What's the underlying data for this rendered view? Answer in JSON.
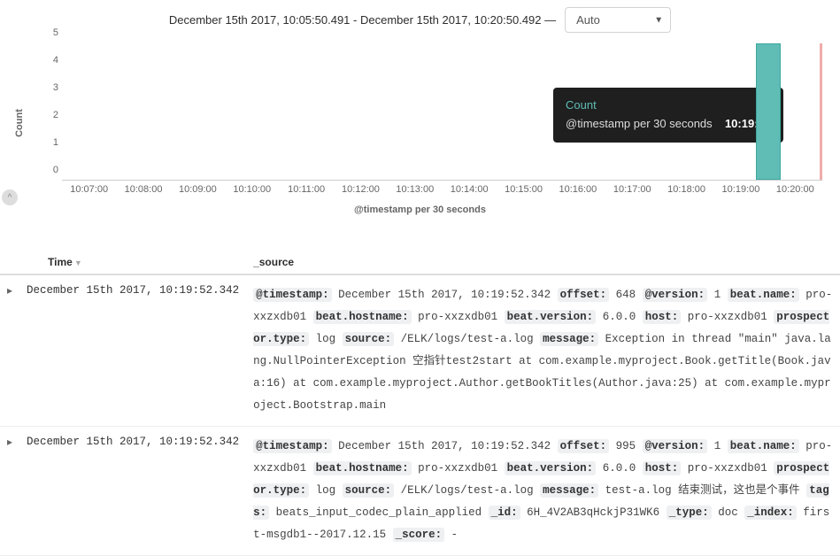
{
  "header": {
    "time_range": "December 15th 2017, 10:05:50.491 - December 15th 2017, 10:20:50.492 —",
    "interval_selected": "Auto"
  },
  "chart_data": {
    "type": "bar",
    "ylabel": "Count",
    "xlabel": "@timestamp per 30 seconds",
    "ylim": [
      0,
      5
    ],
    "y_ticks": [
      0,
      1,
      2,
      3,
      4,
      5
    ],
    "x_ticks": [
      "10:07:00",
      "10:08:00",
      "10:09:00",
      "10:10:00",
      "10:11:00",
      "10:12:00",
      "10:13:00",
      "10:14:00",
      "10:15:00",
      "10:16:00",
      "10:17:00",
      "10:18:00",
      "10:19:00",
      "10:20:00"
    ],
    "bars": [
      {
        "bucket": "10:19:30",
        "value": 5
      }
    ],
    "tooltip": {
      "count_label": "Count",
      "count_value": "5",
      "ts_label": "@timestamp per 30 seconds",
      "ts_value": "10:19:30"
    }
  },
  "table": {
    "columns": {
      "time": "Time",
      "source": "_source"
    },
    "rows": [
      {
        "time": "December 15th 2017, 10:19:52.342",
        "fields": [
          {
            "k": "@timestamp",
            "v": "December 15th 2017, 10:19:52.342"
          },
          {
            "k": "offset",
            "v": "648"
          },
          {
            "k": "@version",
            "v": "1"
          },
          {
            "k": "beat.name",
            "v": "pro-xxzxdb01"
          },
          {
            "k": "beat.hostname",
            "v": "pro-xxzxdb01"
          },
          {
            "k": "beat.version",
            "v": "6.0.0"
          },
          {
            "k": "host",
            "v": "pro-xxzxdb01"
          },
          {
            "k": "prospector.type",
            "v": "log"
          },
          {
            "k": "source",
            "v": "/ELK/logs/test-a.log"
          },
          {
            "k": "message",
            "v": "Exception in thread \"main\" java.lang.NullPointerException 空指针test2start at com.example.myproject.Book.getTitle(Book.java:16) at com.example.myproject.Author.getBookTitles(Author.java:25) at com.example.myproject.Bootstrap.main"
          }
        ]
      },
      {
        "time": "December 15th 2017, 10:19:52.342",
        "fields": [
          {
            "k": "@timestamp",
            "v": "December 15th 2017, 10:19:52.342"
          },
          {
            "k": "offset",
            "v": "995"
          },
          {
            "k": "@version",
            "v": "1"
          },
          {
            "k": "beat.name",
            "v": "pro-xxzxdb01"
          },
          {
            "k": "beat.hostname",
            "v": "pro-xxzxdb01"
          },
          {
            "k": "beat.version",
            "v": "6.0.0"
          },
          {
            "k": "host",
            "v": "pro-xxzxdb01"
          },
          {
            "k": "prospector.type",
            "v": "log"
          },
          {
            "k": "source",
            "v": "/ELK/logs/test-a.log"
          },
          {
            "k": "message",
            "v": "test-a.log 结束测试，这也是个事件"
          },
          {
            "k": "tags",
            "v": "beats_input_codec_plain_applied"
          },
          {
            "k": "_id",
            "v": "6H_4V2AB3qHckjP31WK6"
          },
          {
            "k": "_type",
            "v": "doc"
          },
          {
            "k": "_index",
            "v": "first-msgdb1--2017.12.15"
          },
          {
            "k": "_score",
            "v": "-"
          }
        ]
      }
    ]
  }
}
